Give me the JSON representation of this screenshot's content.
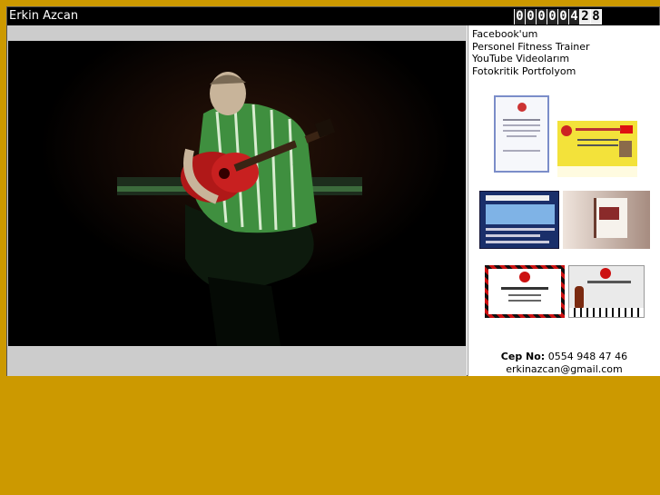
{
  "header": {
    "site_title": "Erkin Azcan",
    "counter_digits": [
      "0",
      "0",
      "0",
      "0",
      "0",
      "4",
      "2",
      "8"
    ]
  },
  "colors": {
    "page_background": "#cc9900",
    "top_bar": "#000000",
    "photo_frame": "#cccccc"
  },
  "main": {
    "photo_icon": "guitarist-photo"
  },
  "sidebar": {
    "links": [
      {
        "label": "Facebook'um"
      },
      {
        "label": "Personel Fitness Trainer"
      },
      {
        "label": "YouTube Videolarım"
      },
      {
        "label": "Fotokritik Portfolyom"
      }
    ],
    "thumbnails": [
      "certificate-thumbnail",
      "id-card-thumbnail",
      "flyer-blue-thumbnail",
      "book-thumbnail",
      "business-card-red-thumbnail",
      "business-card-violin-thumbnail"
    ],
    "contact": {
      "phone_label": "Cep No:",
      "phone_value": "0554 948 47 46",
      "email": "erkinazcan@gmail.com"
    }
  }
}
